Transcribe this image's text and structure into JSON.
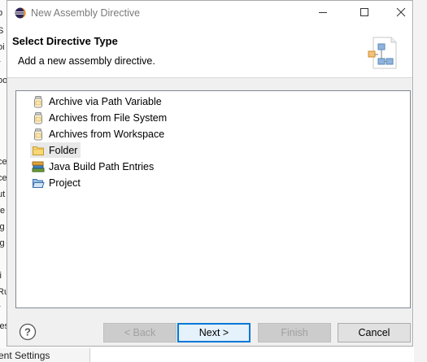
{
  "background_app": {
    "left_fragments": [
      "p",
      "S",
      "oi",
      "r",
      "oo",
      "ce",
      "ce",
      "ut",
      "fe",
      "ig",
      "ig",
      "li",
      "Ru",
      "r",
      "ies"
    ],
    "bottom_text": "ent Settings"
  },
  "dialog": {
    "title": "New Assembly Directive",
    "header": {
      "title": "Select Directive Type",
      "description": "Add a new assembly directive."
    },
    "items": [
      {
        "label": "Archive via Path Variable",
        "icon": "jar-icon"
      },
      {
        "label": "Archives from File System",
        "icon": "jar-icon"
      },
      {
        "label": "Archives from Workspace",
        "icon": "jar-icon"
      },
      {
        "label": "Folder",
        "icon": "folder-icon",
        "selected": true
      },
      {
        "label": "Java Build Path Entries",
        "icon": "library-icon"
      },
      {
        "label": "Project",
        "icon": "project-icon"
      }
    ],
    "buttons": {
      "back": "< Back",
      "next": "Next >",
      "finish": "Finish",
      "cancel": "Cancel"
    }
  }
}
